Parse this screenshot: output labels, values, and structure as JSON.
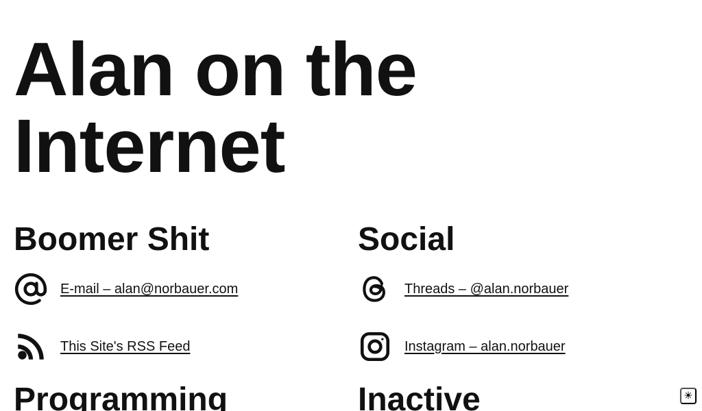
{
  "hero": {
    "title": "Alan on the Internet"
  },
  "sections": {
    "boomer": {
      "title": "Boomer Shit",
      "items": [
        {
          "label": "E-mail – alan@norbauer.com",
          "icon": "at-icon"
        },
        {
          "label": "This Site's RSS Feed",
          "icon": "rss-icon"
        }
      ]
    },
    "social": {
      "title": "Social",
      "items": [
        {
          "label": "Threads – @alan.norbauer",
          "icon": "threads-icon"
        },
        {
          "label": "Instagram – alan.norbauer",
          "icon": "instagram-icon"
        }
      ]
    },
    "programming": {
      "title": "Programming"
    },
    "inactive": {
      "title": "Inactive"
    }
  },
  "controls": {
    "theme_toggle_icon": "sun-icon"
  },
  "colors": {
    "text": "#111111",
    "background": "#ffffff"
  }
}
